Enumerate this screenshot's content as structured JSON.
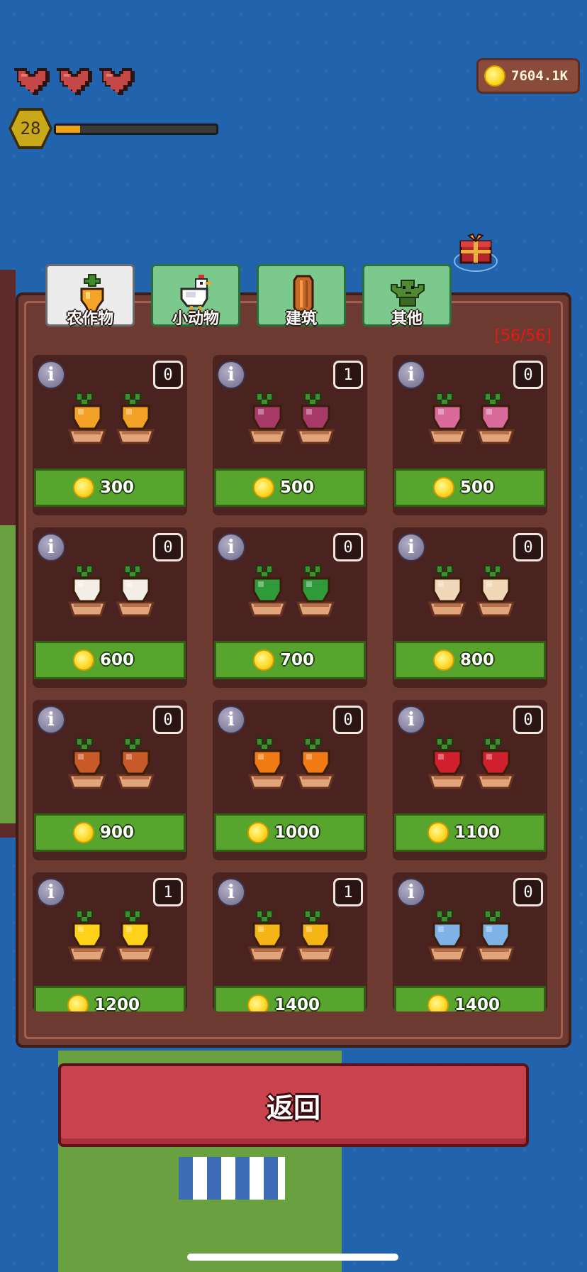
{
  "hud": {
    "hearts": 3,
    "level": "28",
    "xp_progress": 0.15,
    "coins": "7604.1K"
  },
  "panel": {
    "count": "[56/56]",
    "tabs": [
      {
        "label": "农作物",
        "active": true,
        "icon": "carrot-icon"
      },
      {
        "label": "小动物",
        "active": false,
        "icon": "chicken-icon"
      },
      {
        "label": "建筑",
        "active": false,
        "icon": "wood-plank-icon"
      },
      {
        "label": "其他",
        "active": false,
        "icon": "goblin-icon"
      }
    ],
    "items": [
      {
        "owned": "0",
        "price": "300",
        "crop": "orange-sprout",
        "color": "#f2a227"
      },
      {
        "owned": "1",
        "price": "500",
        "crop": "turnip",
        "color": "#a83a6a"
      },
      {
        "owned": "0",
        "price": "500",
        "crop": "pink-flower",
        "color": "#d96a9c"
      },
      {
        "owned": "0",
        "price": "600",
        "crop": "cauliflower",
        "color": "#f4efe6"
      },
      {
        "owned": "0",
        "price": "700",
        "crop": "lettuce",
        "color": "#2f9a3a"
      },
      {
        "owned": "0",
        "price": "800",
        "crop": "onion",
        "color": "#f0d7b8"
      },
      {
        "owned": "0",
        "price": "900",
        "crop": "carrot-sprout",
        "color": "#c85a2a"
      },
      {
        "owned": "0",
        "price": "1000",
        "crop": "pumpkin",
        "color": "#f07a14"
      },
      {
        "owned": "0",
        "price": "1100",
        "crop": "radish",
        "color": "#d0202e"
      },
      {
        "owned": "1",
        "price": "1200",
        "crop": "sunflower",
        "color": "#ffd21a"
      },
      {
        "owned": "1",
        "price": "1400",
        "crop": "wheat",
        "color": "#f6b516"
      },
      {
        "owned": "0",
        "price": "1400",
        "crop": "blue-crystal",
        "color": "#7fb3e8"
      }
    ]
  },
  "back_button": "返回"
}
